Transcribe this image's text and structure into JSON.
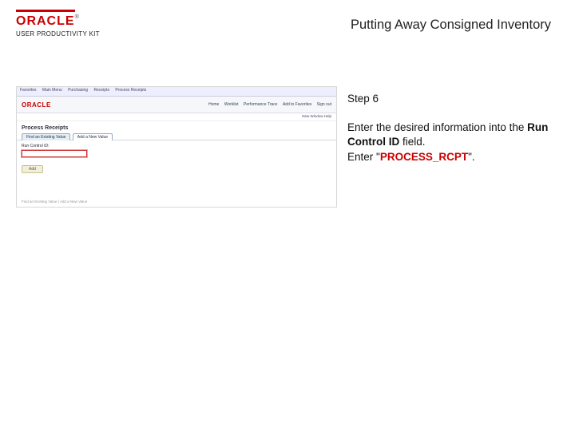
{
  "header": {
    "brand_name": "ORACLE",
    "brand_tm": "®",
    "product_line": "USER PRODUCTIVITY KIT",
    "page_title": "Putting Away Consigned Inventory"
  },
  "instruction": {
    "step_label": "Step 6",
    "line1_a": "Enter the desired information into the ",
    "line1_bold": "Run Control ID",
    "line1_b": " field.",
    "line2_a": "Enter \"",
    "line2_val": "PROCESS_RCPT",
    "line2_b": "\"."
  },
  "mini": {
    "menu": [
      "Favorites",
      "Main Menu",
      "Purchasing",
      "Receipts",
      "Process Receipts"
    ],
    "brand": "ORACLE",
    "nav_links": [
      "Home",
      "Worklist",
      "Performance Trace",
      "Add to Favorites",
      "Sign out"
    ],
    "subbar": "New Window   Help",
    "page_heading": "Process Receipts",
    "tabs": {
      "t1": "Find an Existing Value",
      "t2": "Add a New Value"
    },
    "field_label": "Run Control ID:",
    "button_label": "Add",
    "footer": "Find an Existing Value | Add a New Value"
  }
}
